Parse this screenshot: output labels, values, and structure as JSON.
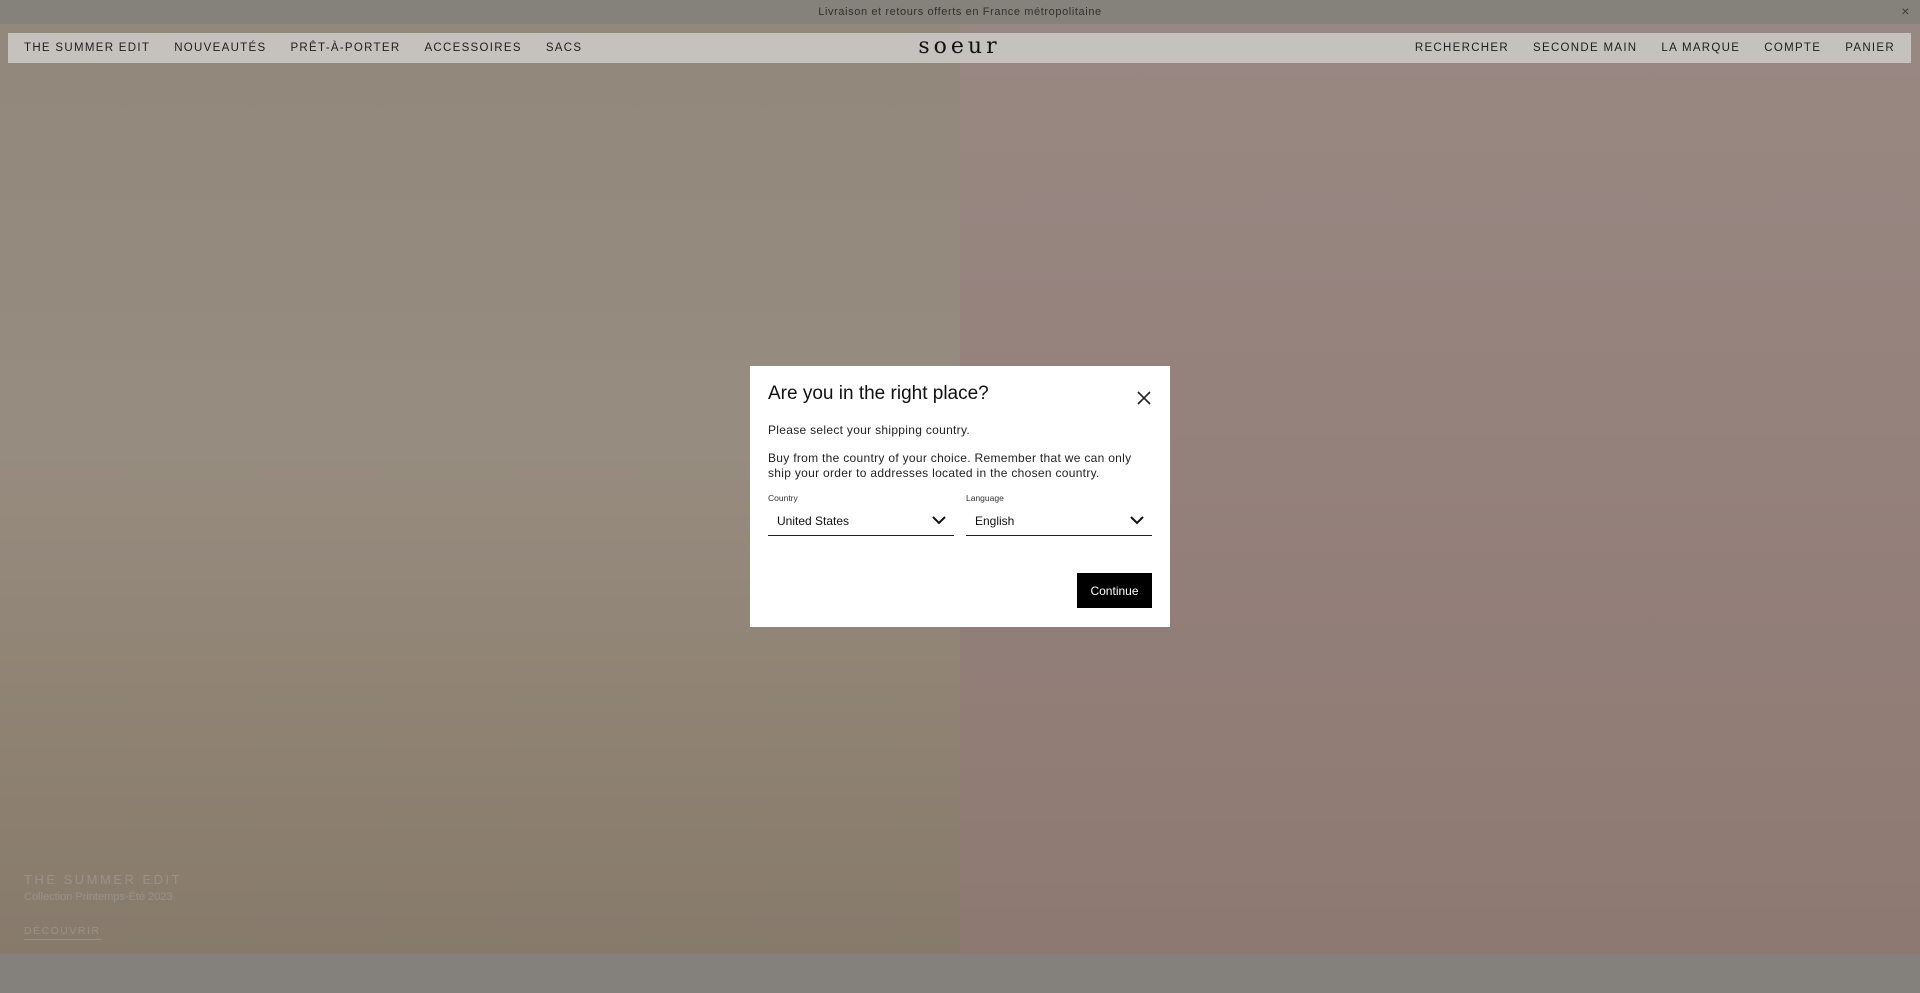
{
  "announcement": {
    "text": "Livraison et retours offerts en France métropolitaine",
    "close": "×"
  },
  "nav": {
    "left": [
      "THE SUMMER EDIT",
      "NOUVEAUTÉS",
      "PRÊT-À-PORTER",
      "ACCESSOIRES",
      "SACS"
    ],
    "logo": "soeur",
    "right": [
      "RECHERCHER",
      "SECONDE MAIN",
      "LA MARQUE",
      "COMPTE",
      "PANIER"
    ]
  },
  "hero": {
    "title": "THE SUMMER EDIT",
    "subtitle": "Collection Printemps-Été 2023",
    "link": "DÉCOUVRIR"
  },
  "modal": {
    "title": "Are you in the right place?",
    "p1": "Please select your shipping country.",
    "p2": "Buy from the country of your choice. Remember that we can only ship your order to addresses located in the chosen country.",
    "country_label": "Country",
    "country_value": "United States",
    "language_label": "Language",
    "language_value": "English",
    "continue": "Continue"
  },
  "icons": {
    "close": "close-icon",
    "chevron": "chevron-down-icon"
  }
}
